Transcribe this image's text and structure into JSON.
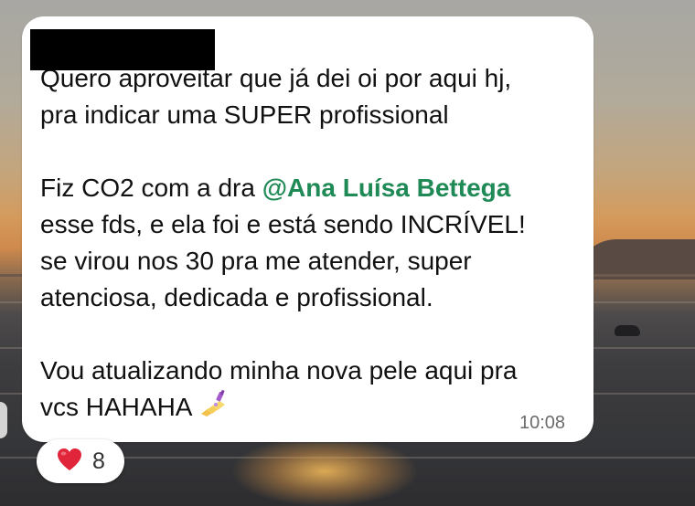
{
  "message": {
    "lines": [
      "Quero aproveitar que já dei oi por aqui hj,",
      "pra indicar uma SUPER profissional",
      "",
      "Fiz CO2 com a dra ",
      "esse fds, e ela foi e está sendo INCRÍVEL!",
      "se virou nos 30 pra me atender, super",
      "atenciosa, dedicada e profissional.",
      "",
      "Vou atualizando minha nova pele aqui pra",
      "vcs HAHAHA"
    ],
    "mention": "@Ana Luísa Bettega",
    "emoji_icon": "nail-polish-emoji",
    "time": "10:08"
  },
  "reaction": {
    "icon": "heart-icon",
    "count": "8"
  },
  "colors": {
    "mention": "#1f8a56",
    "bubble": "#ffffff",
    "heart": "#e0243a"
  }
}
